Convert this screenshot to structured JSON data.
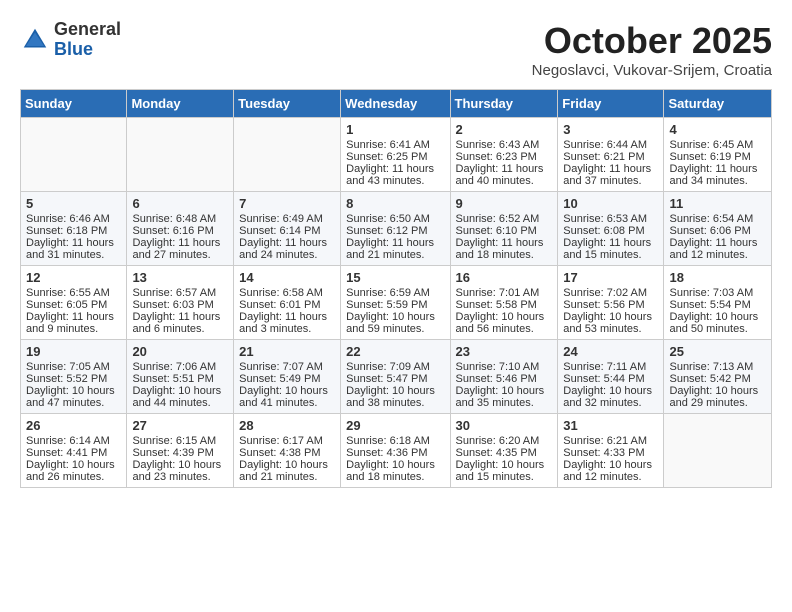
{
  "header": {
    "logo_general": "General",
    "logo_blue": "Blue",
    "month_title": "October 2025",
    "subtitle": "Negoslavci, Vukovar-Srijem, Croatia"
  },
  "days_of_week": [
    "Sunday",
    "Monday",
    "Tuesday",
    "Wednesday",
    "Thursday",
    "Friday",
    "Saturday"
  ],
  "weeks": [
    [
      {
        "day": "",
        "info": ""
      },
      {
        "day": "",
        "info": ""
      },
      {
        "day": "",
        "info": ""
      },
      {
        "day": "1",
        "info": "Sunrise: 6:41 AM\nSunset: 6:25 PM\nDaylight: 11 hours\nand 43 minutes."
      },
      {
        "day": "2",
        "info": "Sunrise: 6:43 AM\nSunset: 6:23 PM\nDaylight: 11 hours\nand 40 minutes."
      },
      {
        "day": "3",
        "info": "Sunrise: 6:44 AM\nSunset: 6:21 PM\nDaylight: 11 hours\nand 37 minutes."
      },
      {
        "day": "4",
        "info": "Sunrise: 6:45 AM\nSunset: 6:19 PM\nDaylight: 11 hours\nand 34 minutes."
      }
    ],
    [
      {
        "day": "5",
        "info": "Sunrise: 6:46 AM\nSunset: 6:18 PM\nDaylight: 11 hours\nand 31 minutes."
      },
      {
        "day": "6",
        "info": "Sunrise: 6:48 AM\nSunset: 6:16 PM\nDaylight: 11 hours\nand 27 minutes."
      },
      {
        "day": "7",
        "info": "Sunrise: 6:49 AM\nSunset: 6:14 PM\nDaylight: 11 hours\nand 24 minutes."
      },
      {
        "day": "8",
        "info": "Sunrise: 6:50 AM\nSunset: 6:12 PM\nDaylight: 11 hours\nand 21 minutes."
      },
      {
        "day": "9",
        "info": "Sunrise: 6:52 AM\nSunset: 6:10 PM\nDaylight: 11 hours\nand 18 minutes."
      },
      {
        "day": "10",
        "info": "Sunrise: 6:53 AM\nSunset: 6:08 PM\nDaylight: 11 hours\nand 15 minutes."
      },
      {
        "day": "11",
        "info": "Sunrise: 6:54 AM\nSunset: 6:06 PM\nDaylight: 11 hours\nand 12 minutes."
      }
    ],
    [
      {
        "day": "12",
        "info": "Sunrise: 6:55 AM\nSunset: 6:05 PM\nDaylight: 11 hours\nand 9 minutes."
      },
      {
        "day": "13",
        "info": "Sunrise: 6:57 AM\nSunset: 6:03 PM\nDaylight: 11 hours\nand 6 minutes."
      },
      {
        "day": "14",
        "info": "Sunrise: 6:58 AM\nSunset: 6:01 PM\nDaylight: 11 hours\nand 3 minutes."
      },
      {
        "day": "15",
        "info": "Sunrise: 6:59 AM\nSunset: 5:59 PM\nDaylight: 10 hours\nand 59 minutes."
      },
      {
        "day": "16",
        "info": "Sunrise: 7:01 AM\nSunset: 5:58 PM\nDaylight: 10 hours\nand 56 minutes."
      },
      {
        "day": "17",
        "info": "Sunrise: 7:02 AM\nSunset: 5:56 PM\nDaylight: 10 hours\nand 53 minutes."
      },
      {
        "day": "18",
        "info": "Sunrise: 7:03 AM\nSunset: 5:54 PM\nDaylight: 10 hours\nand 50 minutes."
      }
    ],
    [
      {
        "day": "19",
        "info": "Sunrise: 7:05 AM\nSunset: 5:52 PM\nDaylight: 10 hours\nand 47 minutes."
      },
      {
        "day": "20",
        "info": "Sunrise: 7:06 AM\nSunset: 5:51 PM\nDaylight: 10 hours\nand 44 minutes."
      },
      {
        "day": "21",
        "info": "Sunrise: 7:07 AM\nSunset: 5:49 PM\nDaylight: 10 hours\nand 41 minutes."
      },
      {
        "day": "22",
        "info": "Sunrise: 7:09 AM\nSunset: 5:47 PM\nDaylight: 10 hours\nand 38 minutes."
      },
      {
        "day": "23",
        "info": "Sunrise: 7:10 AM\nSunset: 5:46 PM\nDaylight: 10 hours\nand 35 minutes."
      },
      {
        "day": "24",
        "info": "Sunrise: 7:11 AM\nSunset: 5:44 PM\nDaylight: 10 hours\nand 32 minutes."
      },
      {
        "day": "25",
        "info": "Sunrise: 7:13 AM\nSunset: 5:42 PM\nDaylight: 10 hours\nand 29 minutes."
      }
    ],
    [
      {
        "day": "26",
        "info": "Sunrise: 6:14 AM\nSunset: 4:41 PM\nDaylight: 10 hours\nand 26 minutes."
      },
      {
        "day": "27",
        "info": "Sunrise: 6:15 AM\nSunset: 4:39 PM\nDaylight: 10 hours\nand 23 minutes."
      },
      {
        "day": "28",
        "info": "Sunrise: 6:17 AM\nSunset: 4:38 PM\nDaylight: 10 hours\nand 21 minutes."
      },
      {
        "day": "29",
        "info": "Sunrise: 6:18 AM\nSunset: 4:36 PM\nDaylight: 10 hours\nand 18 minutes."
      },
      {
        "day": "30",
        "info": "Sunrise: 6:20 AM\nSunset: 4:35 PM\nDaylight: 10 hours\nand 15 minutes."
      },
      {
        "day": "31",
        "info": "Sunrise: 6:21 AM\nSunset: 4:33 PM\nDaylight: 10 hours\nand 12 minutes."
      },
      {
        "day": "",
        "info": ""
      }
    ]
  ]
}
